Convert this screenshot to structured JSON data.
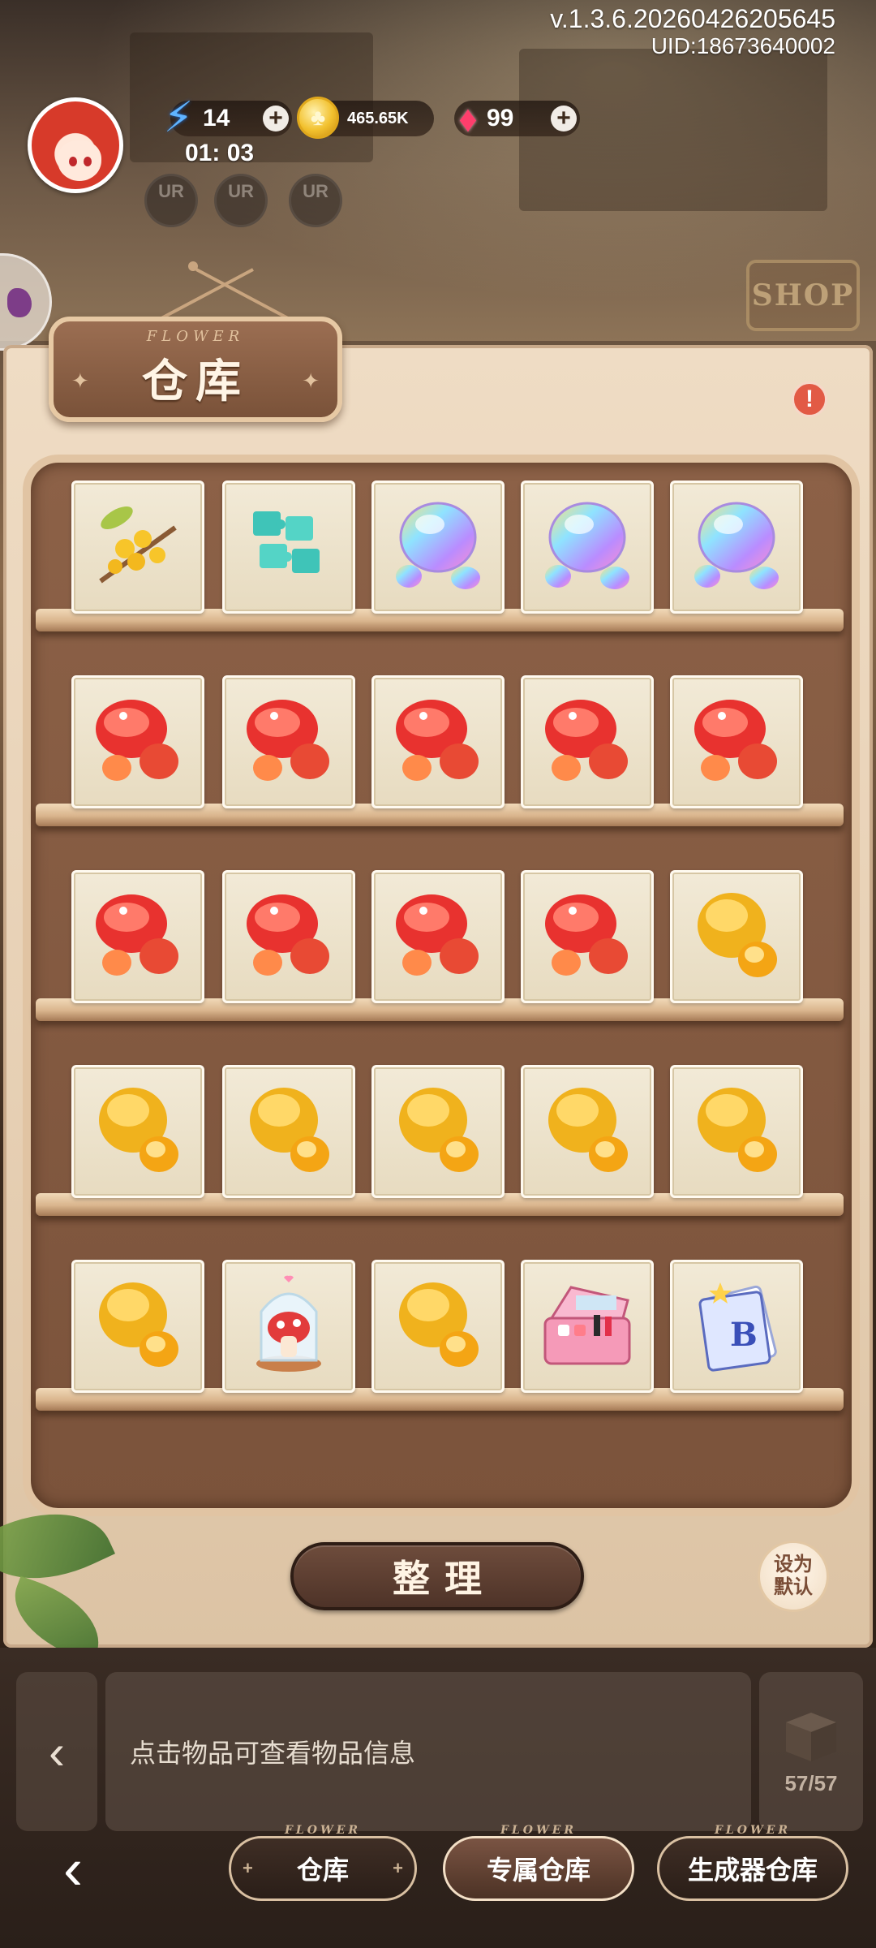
{
  "header": {
    "version": "v.1.3.6.20260426205645",
    "uid": "UID:18673640002",
    "shop_sign": "SHOP"
  },
  "hud": {
    "energy": "14",
    "coins": "465.65K",
    "gems": "99",
    "timer": "01: 03",
    "ur_slots": [
      "UR",
      "UR",
      "UR"
    ]
  },
  "panel": {
    "subtitle": "FLOWER",
    "title": "仓库",
    "alert": "!"
  },
  "storage": {
    "rows": [
      [
        "osmanthus-flower",
        "teal-puzzle-pieces",
        "rainbow-crystal",
        "rainbow-crystal",
        "rainbow-crystal"
      ],
      [
        "red-gem",
        "red-gem",
        "red-gem",
        "red-gem",
        "red-gem"
      ],
      [
        "red-gem",
        "red-gem",
        "red-gem",
        "red-gem",
        "amber-gem"
      ],
      [
        "amber-gem",
        "amber-gem",
        "amber-gem",
        "amber-gem",
        "amber-gem"
      ],
      [
        "amber-gem",
        "mushroom-glass-dome",
        "amber-gem",
        "makeup-case",
        "b-calendar"
      ]
    ]
  },
  "actions": {
    "sort_label": "整理",
    "default_label_line1": "设为",
    "default_label_line2": "默认"
  },
  "footer": {
    "hint": "点击物品可查看物品信息",
    "capacity": "57/57",
    "tabs": [
      {
        "label": "仓库",
        "deco": "FLOWER"
      },
      {
        "label": "专属仓库",
        "deco": "FLOWER"
      },
      {
        "label": "生成器仓库",
        "deco": "FLOWER"
      }
    ],
    "active_tab": "专属仓库"
  },
  "colors": {
    "accent_brown": "#7a5239",
    "panel_bg": "#e6cfb3",
    "cabinet": "#7b533b",
    "gem_red": "#e8322f",
    "gem_amber": "#f0b21d"
  }
}
